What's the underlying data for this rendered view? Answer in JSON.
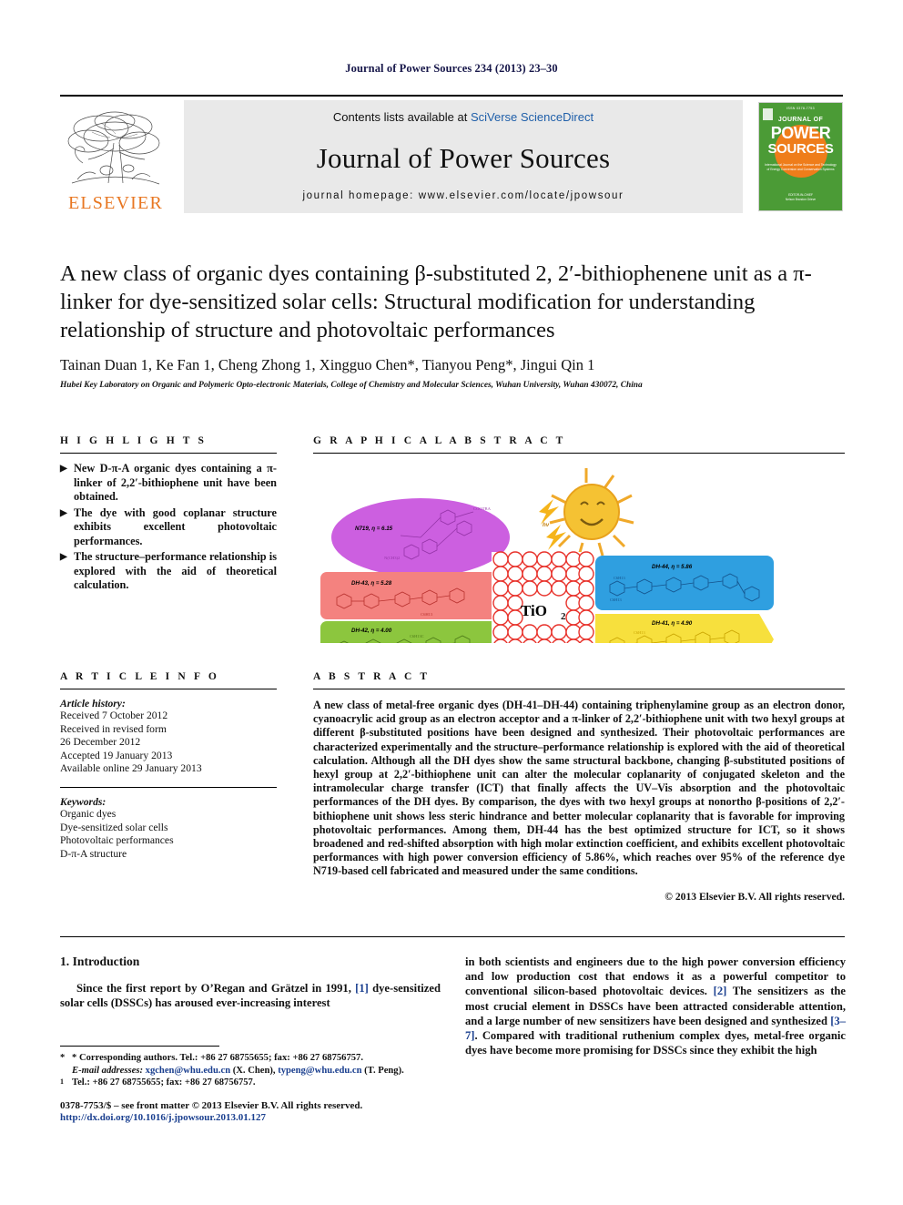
{
  "running_head": "Journal of Power Sources 234 (2013) 23–30",
  "masthead": {
    "contents_prefix": "Contents lists available at ",
    "sciencedirect": "SciVerse ScienceDirect",
    "journal_title": "Journal of Power Sources",
    "homepage": "journal homepage: www.elsevier.com/locate/jpowsour",
    "publisher_word": "ELSEVIER",
    "cover": {
      "top_line": "ISSN 0378-7753",
      "journal_of": "JOURNAL OF",
      "power": "POWER",
      "sources": "SOURCES",
      "subtitle": "International Journal on the Science and Technology of Energy Conversion and Conservation Systems",
      "footer_small": "EDITOR-IN-CHIEF",
      "footer_name": "Nelson Brandon Grieve"
    }
  },
  "title": {
    "line1": "A new class of organic dyes containing β-substituted 2, 2′-bithiophenene unit as",
    "line2": "a π-linker for dye-sensitized solar cells: Structural modification for understanding",
    "line3": "relationship of structure and photovoltaic performances"
  },
  "authors": "Tainan Duan 1, Ke Fan 1, Cheng Zhong 1, Xingguo Chen*, Tianyou Peng*, Jingui Qin 1",
  "affiliation": "Hubei Key Laboratory on Organic and Polymeric Opto-electronic Materials, College of Chemistry and Molecular Sciences, Wuhan University, Wuhan 430072, China",
  "highlights": {
    "heading": "H I G H L I G H T S",
    "items": [
      "New D-π-A organic dyes containing a π-linker of 2,2′-bithiophene unit have been obtained.",
      "The dye with good coplanar structure exhibits excellent photovoltaic performances.",
      "The structure–performance relationship is explored with the aid of theoretical calculation."
    ]
  },
  "graphical_abstract": {
    "heading": "G R A P H I C A L   A B S T R A C T",
    "center_label": "TiO2",
    "photon_label": "hν",
    "dyes": [
      {
        "name": "N719, η = 6.15",
        "color": "#d564e0"
      },
      {
        "name": "DH-43, η = 5.28",
        "color": "#f4827f"
      },
      {
        "name": "DH-42, η = 4.00",
        "color": "#8cc63e"
      },
      {
        "name": "DH-44, η = 5.86",
        "color": "#2f9fe0"
      },
      {
        "name": "DH-41, η = 4.90",
        "color": "#f7e03d"
      }
    ]
  },
  "article_info": {
    "heading": "A R T I C L E   I N F O",
    "history_label": "Article history:",
    "history": [
      "Received 7 October 2012",
      "Received in revised form",
      "26 December 2012",
      "Accepted 19 January 2013",
      "Available online 29 January 2013"
    ],
    "keywords_label": "Keywords:",
    "keywords": [
      "Organic dyes",
      "Dye-sensitized solar cells",
      "Photovoltaic performances",
      "D-π-A structure"
    ]
  },
  "abstract": {
    "heading": "A B S T R A C T",
    "body": "A new class of metal-free organic dyes (DH-41–DH-44) containing triphenylamine group as an electron donor, cyanoacrylic acid group as an electron acceptor and a π-linker of 2,2′-bithiophene unit with two hexyl groups at different β-substituted positions have been designed and synthesized. Their photovoltaic performances are characterized experimentally and the structure–performance relationship is explored with the aid of theoretical calculation. Although all the DH dyes show the same structural backbone, changing β-substituted positions of hexyl group at 2,2′-bithiophene unit can alter the molecular coplanarity of conjugated skeleton and the intramolecular charge transfer (ICT) that finally affects the UV–Vis absorption and the photovoltaic performances of the DH dyes. By comparison, the dyes with two hexyl groups at nonortho β-positions of 2,2′-bithiophene unit shows less steric hindrance and better molecular coplanarity that is favorable for improving photovoltaic performances. Among them, DH-44 has the best optimized structure for ICT, so it shows broadened and red-shifted absorption with high molar extinction coefficient, and exhibits excellent photovoltaic performances with high power conversion efficiency of 5.86%, which reaches over 95% of the reference dye N719-based cell fabricated and measured under the same conditions.",
    "copyright": "© 2013 Elsevier B.V. All rights reserved."
  },
  "introduction": {
    "heading": "1.  Introduction",
    "left_paragraph_pre": "Since the first report by O’Regan and Grätzel in 1991, ",
    "left_cite": "[1]",
    "left_paragraph_post": " dye-sensitized solar cells (DSSCs) has aroused ever-increasing interest",
    "right_part1": "in both scientists and engineers due to the high power conversion efficiency and low production cost that endows it as a powerful competitor to conventional silicon-based photovoltaic devices. ",
    "right_cite1": "[2]",
    "right_part2": " The sensitizers as the most crucial element in DSSCs have been attracted considerable attention, and a large number of new sensitizers have been designed and synthesized ",
    "right_cite2": "[3–7]",
    "right_part3": ". Compared with traditional ruthenium complex dyes, metal-free organic dyes have become more promising for DSSCs since they exhibit the high"
  },
  "footnotes": {
    "corresponding": "* Corresponding authors. Tel.: +86 27 68755655; fax: +86 27 68756757.",
    "email_label": "E-mail addresses:",
    "email1": "xgchen@whu.edu.cn",
    "email1_who": "(X. Chen),",
    "email2": "typeng@whu.edu.cn",
    "email2_who": "(T. Peng).",
    "footnote1_mark": "1",
    "footnote1": "Tel.: +86 27 68755655; fax: +86 27 68756757."
  },
  "footer": {
    "front_matter": "0378-7753/$ – see front matter © 2013 Elsevier B.V. All rights reserved.",
    "doi": "http://dx.doi.org/10.1016/j.jpowsour.2013.01.127"
  },
  "colors": {
    "link_blue": "#1f5fa9",
    "cite_blue": "#1a3f8f",
    "elsevier_orange": "#E87722",
    "cover_green": "#4b9b36",
    "header_navy": "#17174a"
  }
}
